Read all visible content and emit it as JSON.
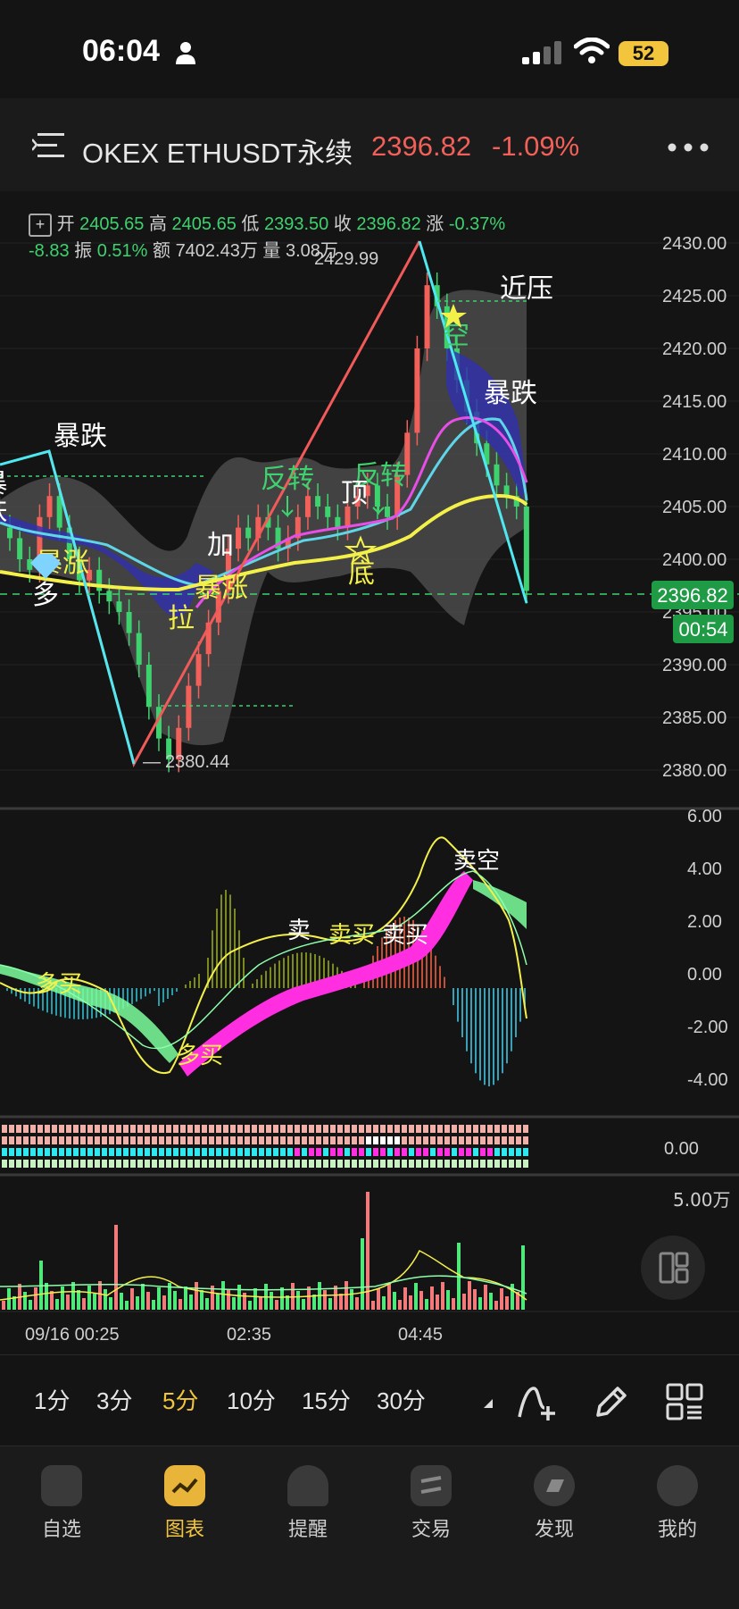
{
  "status": {
    "time": "06:04",
    "battery": "52"
  },
  "header": {
    "title": "OKEX ETHUSDT永续",
    "price": "2396.82",
    "change_pct": "-1.09%"
  },
  "ohlc": {
    "open_label": "开",
    "open": "2405.65",
    "high_label": "高",
    "high": "2405.65",
    "low_label": "低",
    "low": "2393.50",
    "close_label": "收",
    "close": "2396.82",
    "chg_label": "涨",
    "chg": "-0.37%",
    "diff": "-8.83",
    "amp_label": "振",
    "amp": "0.51%",
    "amt_label": "额",
    "amt": "7402.43万",
    "vol_label": "量",
    "vol": "3.08万"
  },
  "price_axis": [
    "2430.00",
    "2425.00",
    "2420.00",
    "2415.00",
    "2410.00",
    "2405.00",
    "2400.00",
    "2395.00",
    "2390.00",
    "2385.00",
    "2380.00"
  ],
  "current_price_tag": "2396.82",
  "countdown_tag": "00:54",
  "high_marker": "2429.99",
  "low_marker": "2380.44",
  "annotations": {
    "baodie1": "暴跌",
    "baodie2": "暴跌",
    "baodie3": "暴跌",
    "baozhang1": "暴涨",
    "baozhang2": "暴涨",
    "duo": "多",
    "jia": "加",
    "la": "拉",
    "fanzhuan1": "反转",
    "fanzhuan2": "反转",
    "ding": "顶",
    "di": "底",
    "kong": "空",
    "jinya": "近压"
  },
  "macd_axis": [
    "6.00",
    "4.00",
    "2.00",
    "0.00",
    "-2.00",
    "-4.00"
  ],
  "macd_labels": {
    "mai1": "卖",
    "mai2": "卖买",
    "mai3": "卖买",
    "kong": "卖空",
    "duo": "多买",
    "duo2": "多买"
  },
  "strip_axis": "0.00",
  "vol_axis": "5.00万",
  "time_axis": [
    "09/16 00:25",
    "02:35",
    "04:45"
  ],
  "timeframes": [
    "1分",
    "3分",
    "5分",
    "10分",
    "15分",
    "30分"
  ],
  "active_timeframe": "5分",
  "nav": [
    {
      "label": "自选",
      "icon": "home-icon"
    },
    {
      "label": "图表",
      "icon": "chart-icon"
    },
    {
      "label": "提醒",
      "icon": "bell-icon"
    },
    {
      "label": "交易",
      "icon": "trade-icon"
    },
    {
      "label": "发现",
      "icon": "discover-icon"
    },
    {
      "label": "我的",
      "icon": "profile-icon"
    }
  ],
  "active_nav": "图表",
  "chart_data": {
    "type": "candlestick",
    "title": "OKEX ETHUSDT永续 5分",
    "ylim": [
      2378,
      2432
    ],
    "candles_approx_close": [
      2402,
      2400,
      2399,
      2404,
      2406,
      2403,
      2400,
      2398,
      2399,
      2397,
      2396,
      2395,
      2393,
      2390,
      2386,
      2383,
      2381,
      2384,
      2388,
      2391,
      2394,
      2397,
      2401,
      2403,
      2402,
      2404,
      2403,
      2401,
      2402,
      2404,
      2406,
      2405,
      2404,
      2403,
      2405,
      2406,
      2407,
      2405,
      2404,
      2408,
      2412,
      2420,
      2426,
      2424,
      2420,
      2417,
      2414,
      2411,
      2409,
      2407,
      2406,
      2405,
      2397
    ],
    "ma_yellow_approx": [
      2399,
      2399,
      2398,
      2398,
      2397,
      2397,
      2397,
      2397,
      2397,
      2397,
      2398,
      2398,
      2399,
      2399,
      2400,
      2400,
      2401,
      2402,
      2403,
      2404,
      2405,
      2406,
      2406,
      2406,
      2406
    ],
    "high": 2429.99,
    "low": 2380.44,
    "last": 2396.82
  }
}
